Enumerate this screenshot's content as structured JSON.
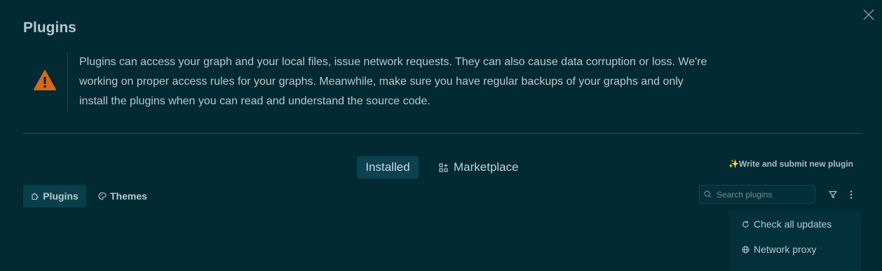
{
  "dialog": {
    "title": "Plugins",
    "close_icon": "close-icon"
  },
  "warning": {
    "icon": "warning-triangle-icon",
    "text": "Plugins can access your graph and your local files, issue network requests. They can also cause data corruption or loss. We're working on proper access rules for your graphs. Meanwhile, make sure you have regular backups of your graphs and only install the plugins when you can read and understand the source code."
  },
  "tabs": [
    {
      "label": "Installed",
      "active": true
    },
    {
      "label": "Marketplace",
      "icon": "apps-grid-icon",
      "active": false
    }
  ],
  "write_link": "✨Write and submit new plugin",
  "subtabs": [
    {
      "label": "Plugins",
      "icon": "puzzle-icon",
      "active": true
    },
    {
      "label": "Themes",
      "icon": "palette-icon",
      "active": false
    }
  ],
  "search": {
    "placeholder": "Search plugins",
    "value": "",
    "icon": "search-icon"
  },
  "toolbar_icons": [
    "filter-icon",
    "more-vertical-icon"
  ],
  "menu": {
    "items": [
      {
        "label": "Check all updates",
        "icon": "refresh-icon"
      },
      {
        "label": "Network proxy",
        "icon": "globe-icon"
      }
    ]
  },
  "colors": {
    "background": "#022a33",
    "warning_icon": "#d4681e",
    "active_tab": "#0a4250"
  }
}
